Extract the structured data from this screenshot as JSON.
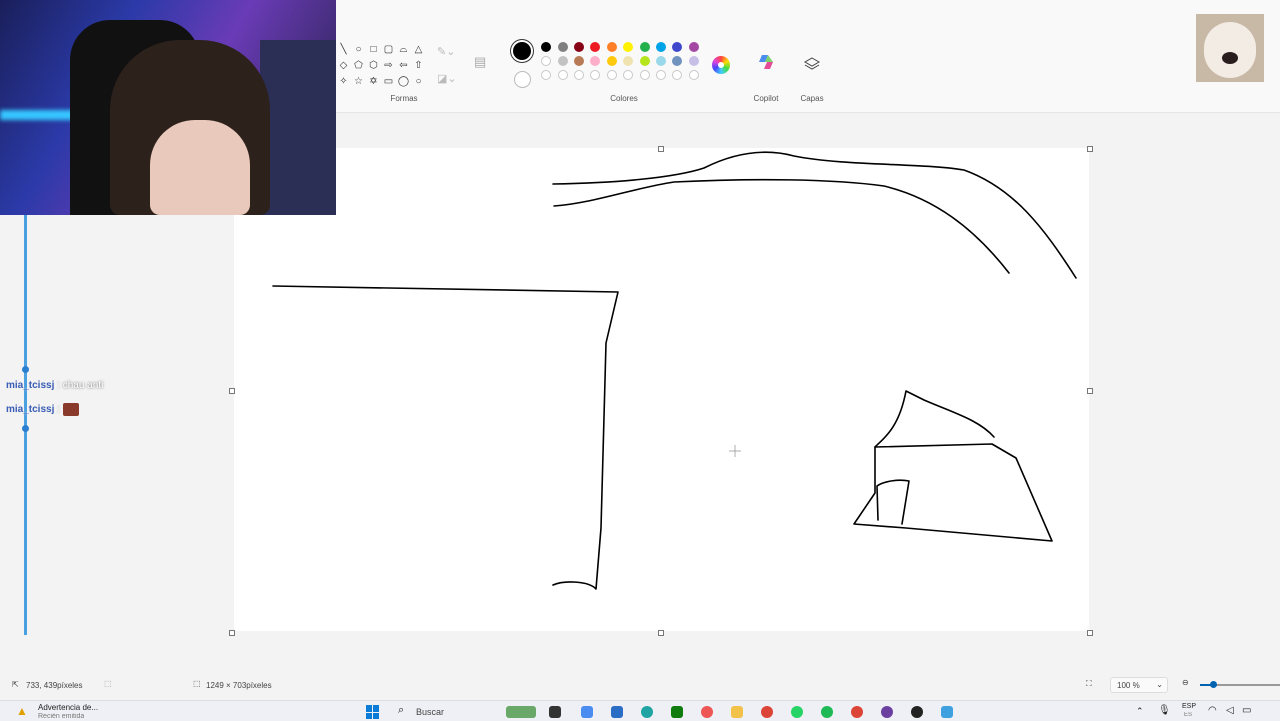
{
  "ribbon": {
    "shapes_label": "Formas",
    "colors_label": "Colores",
    "copilot_label": "Copilot",
    "layers_label": "Capas"
  },
  "colors": {
    "primary": "#000000",
    "secondary": "#ffffff",
    "palette_row1": [
      "#000000",
      "#7f7f7f",
      "#880015",
      "#ed1c24",
      "#ff7f27",
      "#fff200",
      "#22b14c",
      "#00a2e8",
      "#3f48cc",
      "#a349a4"
    ],
    "palette_row2": [
      "#ffffff",
      "#c3c3c3",
      "#b97a57",
      "#ffaec9",
      "#ffc90e",
      "#efe4b0",
      "#b5e61d",
      "#99d9ea",
      "#7092be",
      "#c8bfe7"
    ],
    "palette_row3_count": 10
  },
  "chat": {
    "messages": [
      {
        "user": "mia_tcissj",
        "text": "chau anti"
      },
      {
        "user": "mia_tcissj",
        "text": ""
      }
    ]
  },
  "status": {
    "cursor_position": "733, 439píxeles",
    "canvas_size": "1249 × 703píxeles",
    "zoom": "100 %"
  },
  "taskbar": {
    "notification_title": "Advertencia de...",
    "notification_sub": "Recién emitida",
    "search_placeholder": "Buscar",
    "language": "ESP",
    "language_sub": "ES"
  }
}
